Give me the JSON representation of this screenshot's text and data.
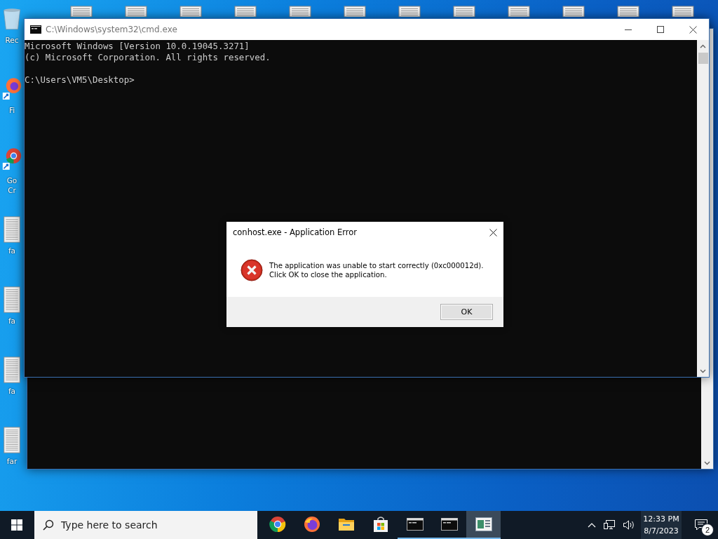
{
  "desktop_icons": [
    {
      "kind": "recycle-bin",
      "label": "Rec"
    },
    {
      "kind": "firefox",
      "label": "Fi"
    },
    {
      "kind": "chrome",
      "label": "Go Cr"
    },
    {
      "kind": "text-file",
      "label": "fa"
    },
    {
      "kind": "text-file",
      "label": "fa"
    },
    {
      "kind": "text-file",
      "label": "fa"
    },
    {
      "kind": "text-file",
      "label": "far"
    }
  ],
  "console_window": {
    "title": "C:\\Windows\\system32\\cmd.exe",
    "lines": [
      "Microsoft Windows [Version 10.0.19045.3271]",
      "(c) Microsoft Corporation. All rights reserved."
    ],
    "prompt": "C:\\Users\\VM5\\Desktop>"
  },
  "error_dialog": {
    "title": "conhost.exe - Application Error",
    "message_lines": [
      "The application was unable to start correctly (0xc000012d).",
      "Click OK to close the application."
    ],
    "button": "OK"
  },
  "taskbar": {
    "search_placeholder": "Type here to search",
    "apps": [
      {
        "kind": "chrome",
        "running": false,
        "selected": false
      },
      {
        "kind": "firefox",
        "running": false,
        "selected": false
      },
      {
        "kind": "folder",
        "running": false,
        "selected": false
      },
      {
        "kind": "store",
        "running": false,
        "selected": false
      },
      {
        "kind": "console",
        "running": true,
        "selected": false
      },
      {
        "kind": "console",
        "running": true,
        "selected": false
      },
      {
        "kind": "notepad",
        "running": true,
        "selected": true
      }
    ],
    "clock": {
      "time": "12:33 PM",
      "date": "8/7/2023"
    },
    "notification_count": "2"
  }
}
